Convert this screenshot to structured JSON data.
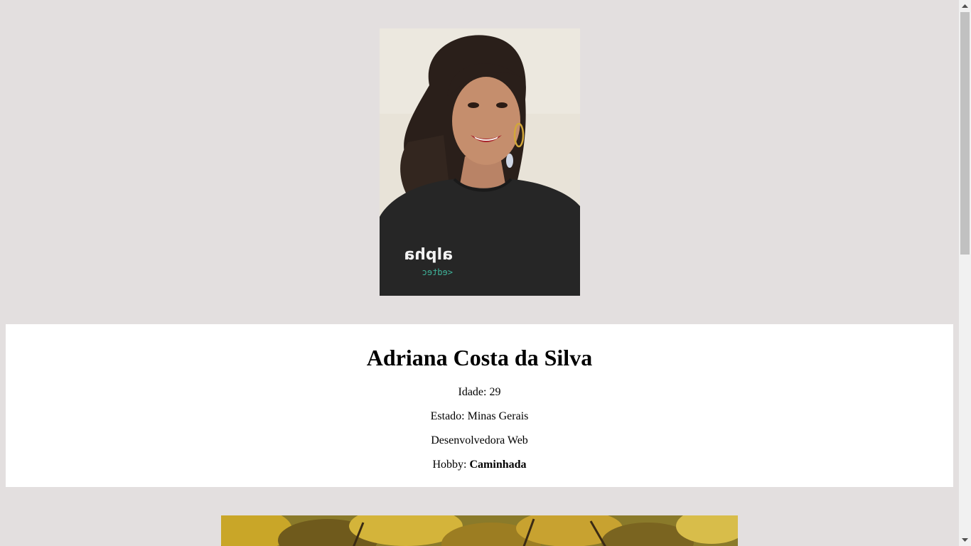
{
  "profile": {
    "name": "Adriana Costa da Silva",
    "age_line": "Idade: 29",
    "state_line": "Estado: Minas Gerais",
    "role_line": "Desenvolvedora Web",
    "hobby_label": "Hobby: ",
    "hobby_value": "Caminhada",
    "shirt_text_main": "alpha",
    "shirt_text_sub": "<edtec"
  },
  "colors": {
    "background": "#e3dfdf",
    "card": "#ffffff",
    "text": "#000000"
  },
  "icons": {
    "scroll_up": "triangle-up-icon",
    "scroll_down": "triangle-down-icon"
  }
}
